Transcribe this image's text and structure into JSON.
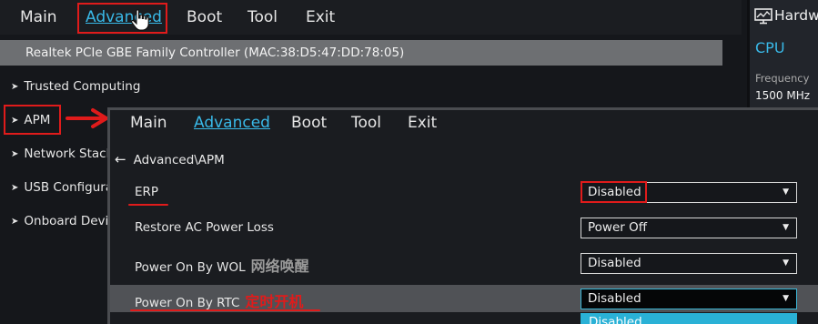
{
  "bg": {
    "menu": [
      "Main",
      "Advanced",
      "Boot",
      "Tool",
      "Exit"
    ],
    "banner": "Realtek PCIe GBE Family Controller (MAC:38:D5:47:DD:78:05)",
    "items": [
      "Trusted Computing",
      "APM",
      "Network Stack",
      "USB Configura",
      "Onboard Devi"
    ],
    "item_icon": "➤"
  },
  "right_panel": {
    "title": "Hardw",
    "section": "CPU",
    "freq_label": "Frequency",
    "freq_value": "1500 MHz"
  },
  "fg": {
    "menu": [
      "Main",
      "Advanced",
      "Boot",
      "Tool",
      "Exit"
    ],
    "breadcrumb": "Advanced\\APM",
    "rows": [
      {
        "label": "ERP",
        "annotation": "",
        "value": "Disabled"
      },
      {
        "label": "Restore AC Power Loss",
        "annotation": "",
        "value": "Power Off"
      },
      {
        "label": "Power On By WOL",
        "annotation": "网络唤醒",
        "value": "Disabled"
      },
      {
        "label": "Power On By RTC",
        "annotation": "定时开机",
        "value": "Disabled"
      }
    ],
    "dropdown_option": "Disabled"
  },
  "colors": {
    "accent": "#39b9e8",
    "highlight": "#e01b1b",
    "selected_row": "#505256"
  }
}
